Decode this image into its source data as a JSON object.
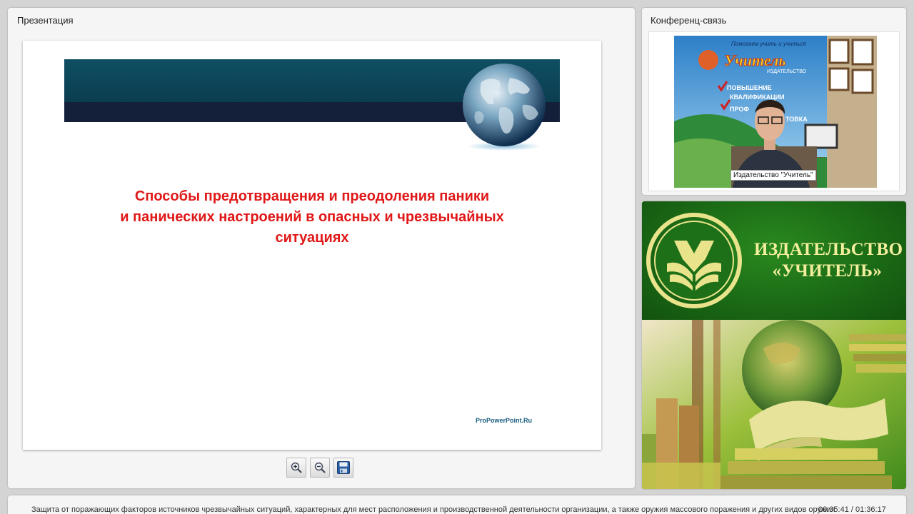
{
  "presentation": {
    "title": "Презентация",
    "slide": {
      "heading_lines": [
        "Способы предотвращения и преодоления паники",
        "и панических настроений в опасных и чрезвычайных",
        "ситуациях"
      ],
      "credit": "ProPowerPoint.Ru",
      "colors": {
        "heading": "#e01818",
        "banner": "#0f4f63",
        "banner_dark": "#14203a"
      }
    },
    "toolbar": {
      "zoom_in_icon": "zoom-in-icon",
      "zoom_out_icon": "zoom-out-icon",
      "save_icon": "save-icon"
    }
  },
  "conference": {
    "title": "Конференц-связь",
    "video": {
      "caption": "Издательство \"Учитель\"",
      "banner_lines": [
        "Помогаем учить и учиться",
        "Учитель",
        "ИЗДАТЕЛЬСТВО",
        "ПОВЫШЕНИЕ",
        "КВАЛИФИКАЦИИ",
        "ПРОФ",
        "ТОВКА"
      ]
    }
  },
  "publisher": {
    "name_lines": [
      "ИЗДАТЕЛЬСТВО",
      "«УЧИТЕЛЬ»"
    ],
    "colors": {
      "green": "#1c6b16",
      "text": "#f3ef9e"
    }
  },
  "footer": {
    "title": "Защита от поражающих факторов источников чрезвычайных ситуаций, характерных для мест расположения и производственной деятельности организации, а также оружия массового поражения и других видов оружия",
    "time": "00:05:41 / 01:36:17"
  }
}
